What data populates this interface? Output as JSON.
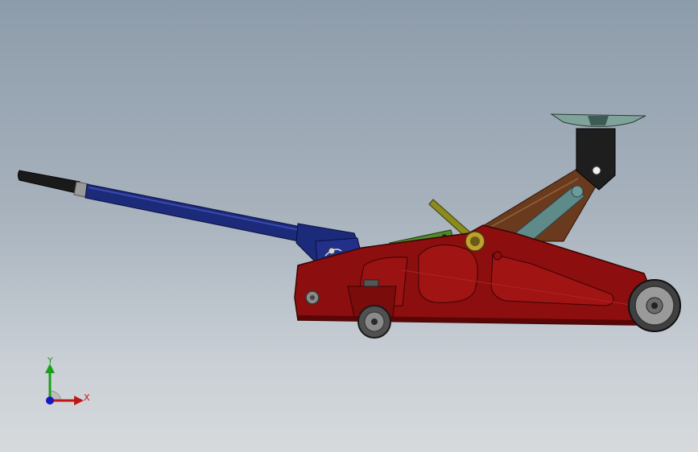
{
  "viewport": {
    "model": "floor-jack-assembly"
  },
  "triad": {
    "x_label": "X",
    "y_label": "Y"
  },
  "colors": {
    "frame_red": "#8c0e0e",
    "frame_dark": "#5a0606",
    "handle_blue": "#1c2a7a",
    "grip_black": "#1a1a1a",
    "lift_arm_brown": "#6a3a1e",
    "link_teal": "#5f8a8a",
    "saddle_teal": "#7fa39a",
    "release_green": "#4f8a2a",
    "lever_olive": "#8a8a1e",
    "axis_x": "#c01818",
    "axis_y": "#18a018",
    "axis_z": "#1818c0"
  }
}
